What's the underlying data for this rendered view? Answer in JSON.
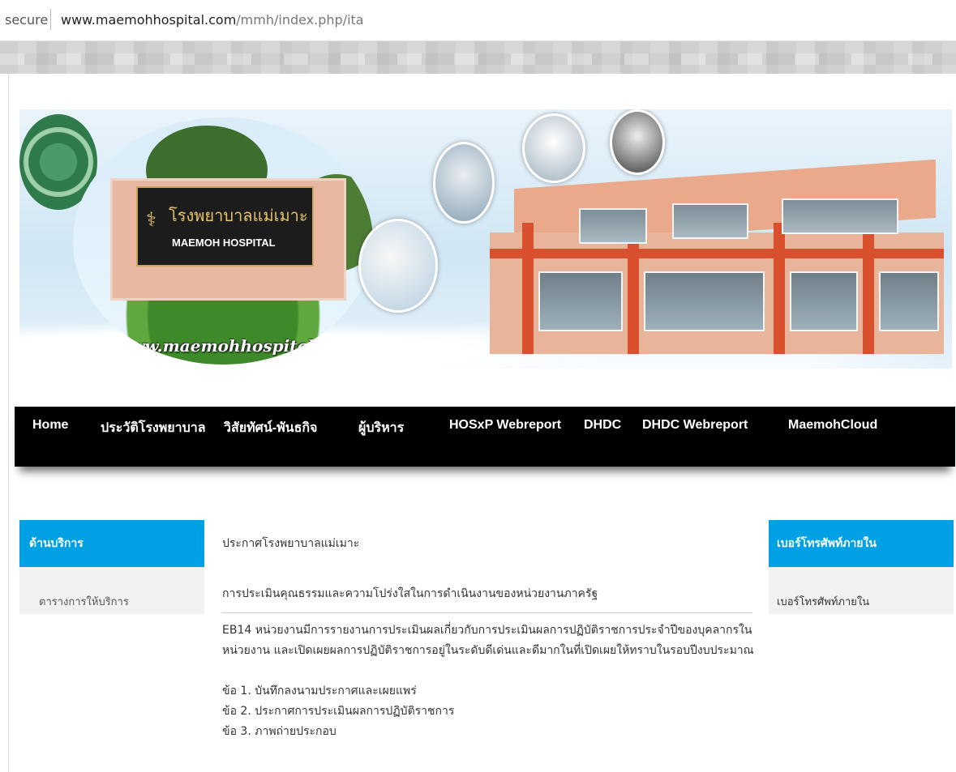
{
  "browser": {
    "secure_label": "secure",
    "url_domain": "www.maemohhospital.com",
    "url_path": "/mmh/index.php/ita"
  },
  "banner": {
    "sign_thai": "โรงพยาบาลแม่เมาะ",
    "sign_english": "MAEMOH HOSPITAL",
    "website": "www.maemohhospital.com"
  },
  "nav": {
    "items": [
      "Home",
      "ประวัติโรงพยาบาล",
      "วิสัยทัศน์-พันธกิจ",
      "ผู้บริหาร",
      "HOSxP Webreport",
      "DHDC",
      "DHDC Webreport",
      "MaemohCloud"
    ]
  },
  "left_sidebar": {
    "title": "ด้านบริการ",
    "item": "ตารางการให้บริการ"
  },
  "right_sidebar": {
    "title": "เบอร์โทรศัพท์ภายใน",
    "item": "เบอร์โทรศัพท์ภายใน"
  },
  "content": {
    "heading": "ประกาศโรงพยาบาลแม่เมาะ",
    "subheading": "การประเมินคุณธรรมและความโปร่งใสในการดำเนินงานของหน่วยงานภาครัฐ",
    "paragraph": "EB14 หน่วยงานมีการรายงานการประเมินผลเกี่ยวกับการประเมินผลการปฏิบัติราชการประจำปีของบุคลากรในหน่วยงาน และเปิดเผยผลการปฏิบัติราชการอยู่ในระดับดีเด่นและดีมากในที่เปิดเผยให้ทราบในรอบปีงบประมาณ",
    "items": [
      "ข้อ 1. บันทึกลงนามประกาศและเผยแพร่",
      "ข้อ 2. ประกาศการประเมินผลการปฏิบัติราชการ",
      "ข้อ 3. ภาพถ่ายประกอบ"
    ]
  }
}
